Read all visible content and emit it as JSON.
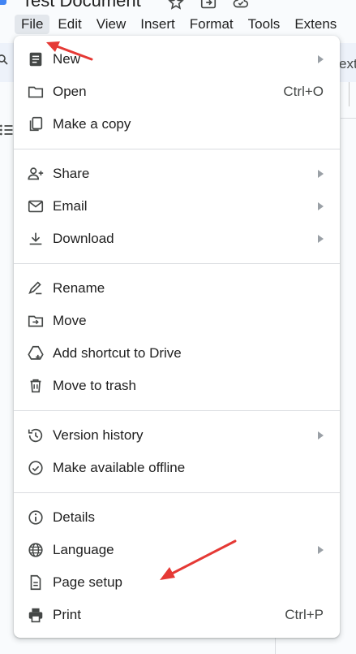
{
  "document": {
    "title": "Test Document"
  },
  "title_icons": [
    "star-icon",
    "move-to-folder-icon",
    "cloud-saved-icon"
  ],
  "menubar": {
    "items": [
      {
        "label": "File",
        "active": true
      },
      {
        "label": "Edit"
      },
      {
        "label": "View"
      },
      {
        "label": "Insert"
      },
      {
        "label": "Format"
      },
      {
        "label": "Tools"
      },
      {
        "label": "Extens"
      }
    ]
  },
  "toolbar": {
    "right_text": "ext"
  },
  "file_menu": {
    "items": [
      {
        "label": "New",
        "icon": "doc-icon",
        "submenu": true
      },
      {
        "label": "Open",
        "icon": "folder-icon",
        "shortcut": "Ctrl+O"
      },
      {
        "label": "Make a copy",
        "icon": "copy-icon"
      },
      {
        "label": "Share",
        "icon": "person-add-icon",
        "submenu": true
      },
      {
        "label": "Email",
        "icon": "mail-icon",
        "submenu": true
      },
      {
        "label": "Download",
        "icon": "download-icon",
        "submenu": true
      },
      {
        "label": "Rename",
        "icon": "rename-icon"
      },
      {
        "label": "Move",
        "icon": "move-folder-icon"
      },
      {
        "label": "Add shortcut to Drive",
        "icon": "drive-shortcut-icon"
      },
      {
        "label": "Move to trash",
        "icon": "trash-icon"
      },
      {
        "label": "Version history",
        "icon": "history-icon",
        "submenu": true
      },
      {
        "label": "Make available offline",
        "icon": "offline-icon"
      },
      {
        "label": "Details",
        "icon": "info-icon"
      },
      {
        "label": "Language",
        "icon": "globe-icon",
        "submenu": true
      },
      {
        "label": "Page setup",
        "icon": "page-setup-icon"
      },
      {
        "label": "Print",
        "icon": "print-icon",
        "shortcut": "Ctrl+P"
      }
    ]
  },
  "colors": {
    "annotation_arrow": "#e53935",
    "menu_background": "#ffffff",
    "active_menu_background": "#e3e7ec",
    "app_blue": "#4285f4"
  }
}
